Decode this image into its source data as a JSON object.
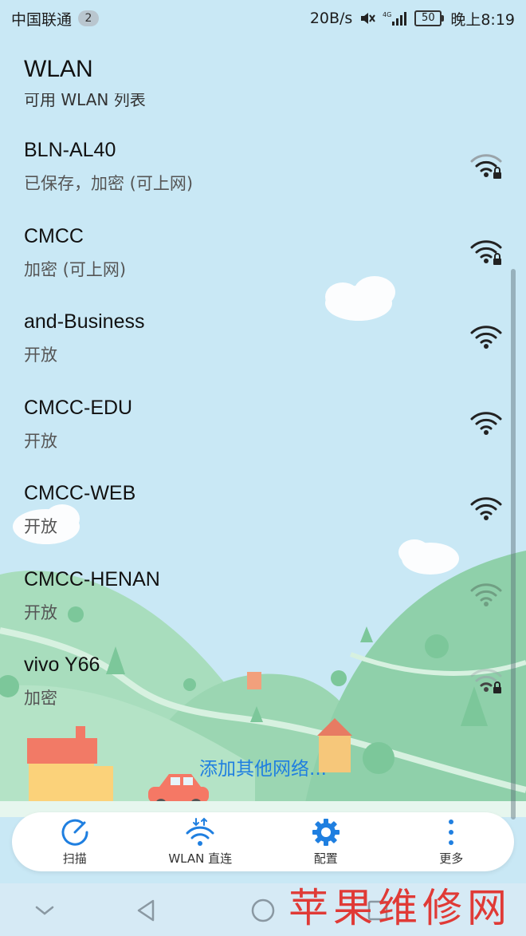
{
  "status_bar": {
    "carrier": "中国联通",
    "sim_badge": "2",
    "net_speed": "20B/s",
    "battery": "50",
    "time": "晚上8:19"
  },
  "title": "WLAN",
  "list_header": "可用 WLAN 列表",
  "networks": [
    {
      "name": "BLN-AL40",
      "status": "已保存，加密 (可上网)",
      "secured": true,
      "signal": "wifi-lock-icon"
    },
    {
      "name": "CMCC",
      "status": "加密 (可上网)",
      "secured": true,
      "signal": "wifi-lock-icon"
    },
    {
      "name": "and-Business",
      "status": "开放",
      "secured": false,
      "signal": "wifi-icon"
    },
    {
      "name": "CMCC-EDU",
      "status": "开放",
      "secured": false,
      "signal": "wifi-icon"
    },
    {
      "name": "CMCC-WEB",
      "status": "开放",
      "secured": false,
      "signal": "wifi-icon"
    },
    {
      "name": "CMCC-HENAN",
      "status": "开放",
      "secured": false,
      "signal": "wifi-icon"
    },
    {
      "name": "vivo Y66",
      "status": "加密",
      "secured": true,
      "signal": "wifi-lock-icon"
    }
  ],
  "add_network": "添加其他网络...",
  "toolbar": {
    "scan": "扫描",
    "direct": "WLAN 直连",
    "config": "配置",
    "more": "更多"
  },
  "watermark": "苹果维修网",
  "colors": {
    "accent": "#1f7fe0",
    "background": "#c9e8f5",
    "hills": "#9ed9b6"
  }
}
